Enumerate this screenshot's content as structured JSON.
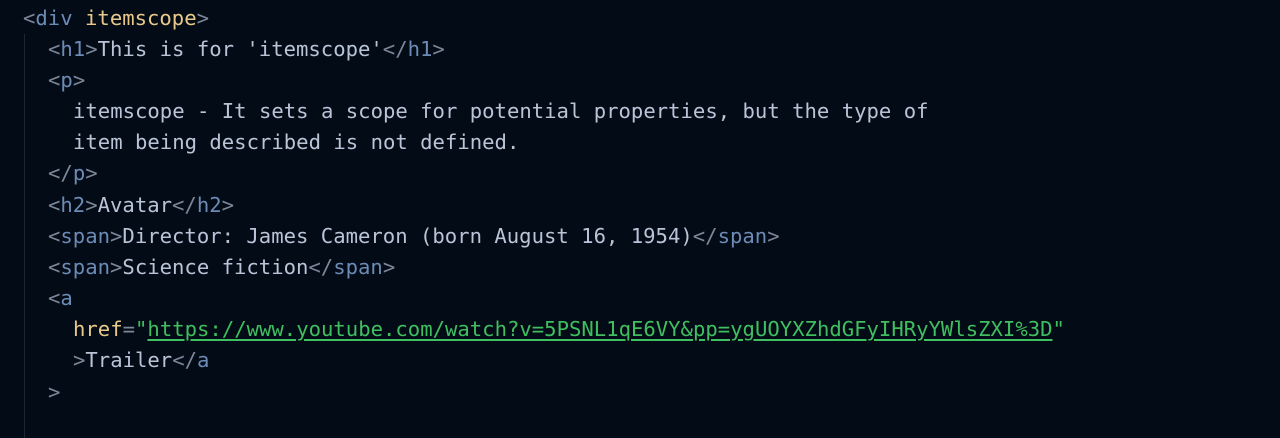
{
  "code": {
    "line1": {
      "open": "<",
      "tag": "div",
      "attr": "itemscope",
      "close": ">"
    },
    "line2": {
      "open": "<",
      "tag": "h1",
      "gt": ">",
      "text": "This is for 'itemscope'",
      "endopen": "</",
      "endtag": "h1",
      "close": ">"
    },
    "line3": {
      "open": "<",
      "tag": "p",
      "close": ">"
    },
    "line4": {
      "text": "itemscope - It sets a scope for potential properties, but the type of"
    },
    "line5": {
      "text": "item being described is not defined."
    },
    "line6": {
      "open": "</",
      "tag": "p",
      "close": ">"
    },
    "line7": {
      "open": "<",
      "tag": "h2",
      "gt": ">",
      "text": "Avatar",
      "endopen": "</",
      "endtag": "h2",
      "close": ">"
    },
    "line8": {
      "open": "<",
      "tag": "span",
      "gt": ">",
      "text": "Director: James Cameron (born August 16, 1954)",
      "endopen": "</",
      "endtag": "span",
      "close": ">"
    },
    "line9": {
      "open": "<",
      "tag": "span",
      "gt": ">",
      "text": "Science fiction",
      "endopen": "</",
      "endtag": "span",
      "close": ">"
    },
    "line10": {
      "open": "<",
      "tag": "a"
    },
    "line11": {
      "attr": "href",
      "eq": "=",
      "quote_open": "\"",
      "url": "https://www.youtube.com/watch?v=5PSNL1qE6VY&pp=ygUOYXZhdGFyIHRyYWlsZXI%3D",
      "quote_close": "\""
    },
    "line12": {
      "gt": ">",
      "text": "Trailer",
      "endopen": "</",
      "endtag": "a"
    },
    "line13": {
      "close": ">"
    }
  },
  "colors": {
    "background": "#030b17",
    "punctuation": "#7c8798",
    "tag": "#6c8bb5",
    "attribute": "#e8c98a",
    "text": "#b9c4d6",
    "string": "#3fbf5f"
  }
}
